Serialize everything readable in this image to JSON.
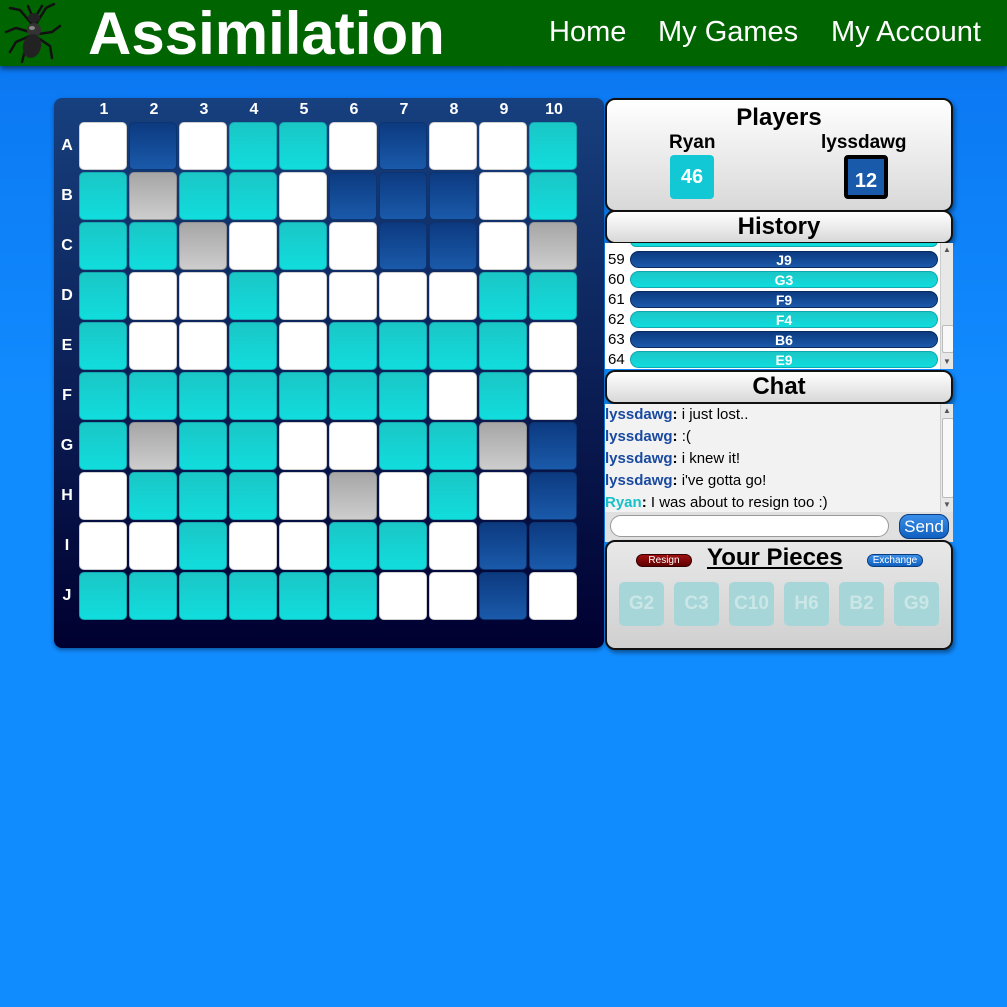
{
  "header": {
    "logo_icon": "ant-icon",
    "title": "Assimilation",
    "nav": [
      "Home",
      "My Games",
      "My Account"
    ],
    "bar_color": "#006400"
  },
  "board": {
    "columns": [
      "1",
      "2",
      "3",
      "4",
      "5",
      "6",
      "7",
      "8",
      "9",
      "10"
    ],
    "rows": [
      "A",
      "B",
      "C",
      "D",
      "E",
      "F",
      "G",
      "H",
      "I",
      "J"
    ],
    "legend": {
      "w": "empty",
      "c": "Ryan (cyan)",
      "b": "lyssdawg (blue)",
      "g": "blocked (gray)"
    },
    "colors": {
      "cyan": "#11dddd",
      "blue": "#1a5aaa",
      "gray": "#bbbbbb",
      "empty": "#ffffff"
    },
    "grid": [
      [
        "w",
        "b",
        "w",
        "c",
        "c",
        "w",
        "b",
        "w",
        "w",
        "c"
      ],
      [
        "c",
        "g",
        "c",
        "c",
        "w",
        "b",
        "b",
        "b",
        "w",
        "c"
      ],
      [
        "c",
        "c",
        "g",
        "w",
        "c",
        "w",
        "b",
        "b",
        "w",
        "g"
      ],
      [
        "c",
        "w",
        "w",
        "c",
        "w",
        "w",
        "w",
        "w",
        "c",
        "c"
      ],
      [
        "c",
        "w",
        "w",
        "c",
        "w",
        "c",
        "c",
        "c",
        "c",
        "w"
      ],
      [
        "c",
        "c",
        "c",
        "c",
        "c",
        "c",
        "c",
        "w",
        "c",
        "w"
      ],
      [
        "c",
        "g",
        "c",
        "c",
        "w",
        "w",
        "c",
        "c",
        "g",
        "b"
      ],
      [
        "w",
        "c",
        "c",
        "c",
        "w",
        "g",
        "w",
        "c",
        "w",
        "b"
      ],
      [
        "w",
        "w",
        "c",
        "w",
        "w",
        "c",
        "c",
        "w",
        "b",
        "b"
      ],
      [
        "c",
        "c",
        "c",
        "c",
        "c",
        "c",
        "w",
        "w",
        "b",
        "w"
      ]
    ]
  },
  "players": {
    "title": "Players",
    "list": [
      {
        "name": "Ryan",
        "score": "46",
        "color": "#11c8d4"
      },
      {
        "name": "lyssdawg",
        "score": "12",
        "color": "#1a5aaa"
      }
    ]
  },
  "history": {
    "title": "History",
    "entries": [
      {
        "num": "59",
        "move": "J9",
        "player": "b"
      },
      {
        "num": "60",
        "move": "G3",
        "player": "c"
      },
      {
        "num": "61",
        "move": "F9",
        "player": "b"
      },
      {
        "num": "62",
        "move": "F4",
        "player": "c"
      },
      {
        "num": "63",
        "move": "B6",
        "player": "b"
      },
      {
        "num": "64",
        "move": "E9",
        "player": "c"
      }
    ]
  },
  "chat": {
    "title": "Chat",
    "messages": [
      {
        "user": "lyssdawg",
        "text": "i just lost..",
        "me": false
      },
      {
        "user": "lyssdawg",
        "text": ":(",
        "me": false
      },
      {
        "user": "lyssdawg",
        "text": "i knew it!",
        "me": false
      },
      {
        "user": "lyssdawg",
        "text": "i've gotta go!",
        "me": false
      },
      {
        "user": "Ryan",
        "text": "I was about to resign too :)",
        "me": true
      }
    ],
    "input_value": "",
    "send_label": "Send"
  },
  "pieces": {
    "title": "Your Pieces",
    "resign_label": "Resign",
    "exchange_label": "Exchange",
    "items": [
      "G2",
      "C3",
      "C10",
      "H6",
      "B2",
      "G9"
    ]
  }
}
